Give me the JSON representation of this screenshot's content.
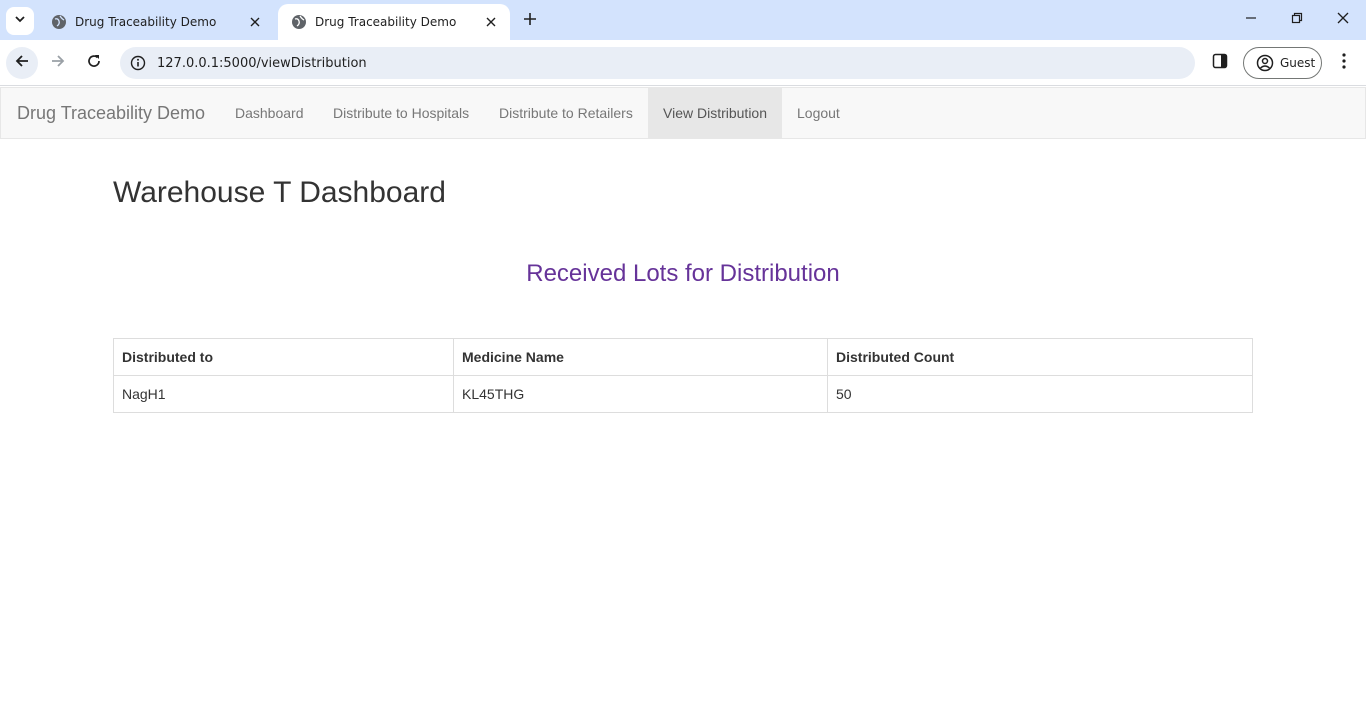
{
  "browser": {
    "tabs": [
      {
        "title": "Drug Traceability Demo",
        "active": false
      },
      {
        "title": "Drug Traceability Demo",
        "active": true
      }
    ],
    "url": "127.0.0.1:5000/viewDistribution",
    "profile_label": "Guest"
  },
  "navbar": {
    "brand": "Drug Traceability Demo",
    "items": [
      {
        "label": "Dashboard",
        "active": false
      },
      {
        "label": "Distribute to Hospitals",
        "active": false
      },
      {
        "label": "Distribute to Retailers",
        "active": false
      },
      {
        "label": "View Distribution",
        "active": true
      },
      {
        "label": "Logout",
        "active": false
      }
    ]
  },
  "page": {
    "title": "Warehouse T Dashboard",
    "section_title": "Received Lots for Distribution"
  },
  "table": {
    "columns": [
      "Distributed to",
      "Medicine Name",
      "Distributed Count"
    ],
    "rows": [
      [
        "NagH1",
        "KL45THG",
        "50"
      ]
    ]
  },
  "colors": {
    "section_title": "#663399",
    "tabstrip": "#d3e3fd",
    "navbar_bg": "#f8f8f8",
    "nav_active_bg": "#e7e7e7"
  }
}
